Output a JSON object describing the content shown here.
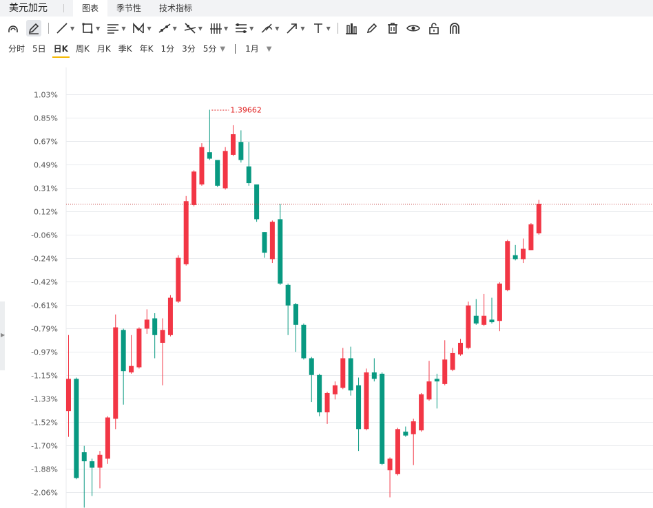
{
  "header": {
    "symbol": "美元加元",
    "tabs": [
      {
        "label": "图表",
        "active": true
      },
      {
        "label": "季节性",
        "active": false
      },
      {
        "label": "技术指标",
        "active": false
      }
    ]
  },
  "toolbar": {
    "tools": [
      {
        "icon": "magnet-circle-icon",
        "caret": false
      },
      {
        "icon": "pencil-icon",
        "caret": false,
        "selected": true
      },
      {
        "icon": "trend-line-icon",
        "caret": true
      },
      {
        "icon": "rectangle-icon",
        "caret": true
      },
      {
        "icon": "fib-lines-icon",
        "caret": true
      },
      {
        "icon": "pattern-icon",
        "caret": true
      },
      {
        "icon": "ray-icon",
        "caret": true
      },
      {
        "icon": "cross-lines-icon",
        "caret": true
      },
      {
        "icon": "gann-fan-icon",
        "caret": true
      },
      {
        "icon": "channel-icon",
        "caret": true
      },
      {
        "icon": "brush-icon",
        "caret": true
      },
      {
        "icon": "arrow-icon",
        "caret": true
      },
      {
        "icon": "text-icon",
        "caret": true
      }
    ],
    "right_tools": [
      {
        "icon": "measure-icon"
      },
      {
        "icon": "edit-icon"
      },
      {
        "icon": "trash-icon"
      },
      {
        "icon": "eye-icon"
      },
      {
        "icon": "lock-icon"
      },
      {
        "icon": "magnet-icon"
      }
    ]
  },
  "periods": {
    "items": [
      {
        "label": "分时",
        "active": false
      },
      {
        "label": "5日",
        "active": false
      },
      {
        "label": "日K",
        "active": true
      },
      {
        "label": "周K",
        "active": false
      },
      {
        "label": "月K",
        "active": false
      },
      {
        "label": "季K",
        "active": false
      },
      {
        "label": "年K",
        "active": false
      },
      {
        "label": "1分",
        "active": false
      },
      {
        "label": "3分",
        "active": false
      },
      {
        "label": "5分",
        "active": false
      }
    ],
    "range": "1月",
    "caret": "▼"
  },
  "chart_data": {
    "type": "candlestick",
    "y_ticks": [
      "1.03%",
      "0.85%",
      "0.67%",
      "0.49%",
      "0.31%",
      "0.12%",
      "-0.06%",
      "-0.24%",
      "-0.42%",
      "-0.61%",
      "-0.79%",
      "-0.97%",
      "-1.15%",
      "-1.33%",
      "-1.52%",
      "-1.70%",
      "-1.88%",
      "-2.06%"
    ],
    "ylim": [
      -2.18,
      1.15
    ],
    "max_label": "1.39662",
    "current_level": 0.18,
    "colors": {
      "up": "#f23645",
      "down": "#089981",
      "grid": "#e9ebee",
      "text": "#555555",
      "max_label": "#e02020",
      "current_line": "#c23b3b"
    },
    "candles": [
      {
        "o": -1.43,
        "c": -1.18,
        "h": -0.84,
        "l": -1.63
      },
      {
        "o": -1.18,
        "c": -1.95,
        "h": -1.17,
        "l": -1.96
      },
      {
        "o": -1.75,
        "c": -1.82,
        "h": -1.7,
        "l": -2.18
      },
      {
        "o": -1.82,
        "c": -1.87,
        "h": -1.8,
        "l": -2.09
      },
      {
        "o": -1.87,
        "c": -1.77,
        "h": -1.74,
        "l": -2.03
      },
      {
        "o": -1.8,
        "c": -1.48,
        "h": -1.47,
        "l": -1.84
      },
      {
        "o": -1.49,
        "c": -0.78,
        "h": -0.68,
        "l": -1.57
      },
      {
        "o": -0.8,
        "c": -1.12,
        "h": -0.79,
        "l": -1.38
      },
      {
        "o": -1.13,
        "c": -1.08,
        "h": -0.84,
        "l": -1.14
      },
      {
        "o": -1.09,
        "c": -0.79,
        "h": -0.78,
        "l": -1.1
      },
      {
        "o": -0.79,
        "c": -0.72,
        "h": -0.64,
        "l": -0.83
      },
      {
        "o": -0.71,
        "c": -0.84,
        "h": -0.67,
        "l": -1.02
      },
      {
        "o": -0.9,
        "c": -0.8,
        "h": -0.71,
        "l": -1.23
      },
      {
        "o": -0.84,
        "c": -0.55,
        "h": -0.53,
        "l": -0.85
      },
      {
        "o": -0.58,
        "c": -0.24,
        "h": -0.22,
        "l": -0.59
      },
      {
        "o": -0.29,
        "c": 0.2,
        "h": 0.24,
        "l": -0.3
      },
      {
        "o": 0.17,
        "c": 0.43,
        "h": 0.44,
        "l": 0.16
      },
      {
        "o": 0.33,
        "c": 0.62,
        "h": 0.65,
        "l": 0.32
      },
      {
        "o": 0.58,
        "c": 0.53,
        "h": 0.91,
        "l": 0.52
      },
      {
        "o": 0.52,
        "c": 0.32,
        "h": 0.51,
        "l": 0.31
      },
      {
        "o": 0.3,
        "c": 0.59,
        "h": 0.62,
        "l": 0.29
      },
      {
        "o": 0.56,
        "c": 0.72,
        "h": 0.79,
        "l": 0.55
      },
      {
        "o": 0.66,
        "c": 0.52,
        "h": 0.75,
        "l": 0.5
      },
      {
        "o": 0.47,
        "c": 0.34,
        "h": 0.66,
        "l": 0.32
      },
      {
        "o": 0.33,
        "c": 0.06,
        "h": 0.32,
        "l": 0.04
      },
      {
        "o": -0.04,
        "c": -0.2,
        "h": -0.04,
        "l": -0.24
      },
      {
        "o": -0.25,
        "c": 0.04,
        "h": 0.05,
        "l": -0.28
      },
      {
        "o": 0.06,
        "c": -0.44,
        "h": 0.18,
        "l": -0.45
      },
      {
        "o": -0.45,
        "c": -0.61,
        "h": -0.44,
        "l": -0.84
      },
      {
        "o": -0.6,
        "c": -0.76,
        "h": -0.59,
        "l": -0.97
      },
      {
        "o": -0.76,
        "c": -1.02,
        "h": -0.75,
        "l": -1.03
      },
      {
        "o": -1.02,
        "c": -1.15,
        "h": -1.01,
        "l": -1.36
      },
      {
        "o": -1.15,
        "c": -1.44,
        "h": -1.14,
        "l": -1.47
      },
      {
        "o": -1.44,
        "c": -1.29,
        "h": -1.28,
        "l": -1.53
      },
      {
        "o": -1.3,
        "c": -1.23,
        "h": -1.2,
        "l": -1.34
      },
      {
        "o": -1.25,
        "c": -1.02,
        "h": -0.94,
        "l": -1.26
      },
      {
        "o": -1.02,
        "c": -1.27,
        "h": -0.93,
        "l": -1.31
      },
      {
        "o": -1.23,
        "c": -1.57,
        "h": -1.17,
        "l": -1.74
      },
      {
        "o": -1.57,
        "c": -1.13,
        "h": -1.1,
        "l": -1.58
      },
      {
        "o": -1.13,
        "c": -1.18,
        "h": -1.02,
        "l": -1.2
      },
      {
        "o": -1.14,
        "c": -1.84,
        "h": -1.13,
        "l": -1.85
      },
      {
        "o": -1.89,
        "c": -1.8,
        "h": -1.79,
        "l": -2.1
      },
      {
        "o": -1.92,
        "c": -1.57,
        "h": -1.56,
        "l": -1.93
      },
      {
        "o": -1.59,
        "c": -1.62,
        "h": -1.55,
        "l": -1.63
      },
      {
        "o": -1.61,
        "c": -1.51,
        "h": -1.49,
        "l": -1.85
      },
      {
        "o": -1.58,
        "c": -1.3,
        "h": -1.29,
        "l": -1.59
      },
      {
        "o": -1.34,
        "c": -1.2,
        "h": -1.04,
        "l": -1.35
      },
      {
        "o": -1.18,
        "c": -1.2,
        "h": -1.14,
        "l": -1.41
      },
      {
        "o": -1.22,
        "c": -1.03,
        "h": -0.88,
        "l": -1.23
      },
      {
        "o": -1.11,
        "c": -0.98,
        "h": -0.94,
        "l": -1.12
      },
      {
        "o": -0.99,
        "c": -0.9,
        "h": -0.87,
        "l": -1.0
      },
      {
        "o": -0.94,
        "c": -0.61,
        "h": -0.58,
        "l": -0.95
      },
      {
        "o": -0.69,
        "c": -0.75,
        "h": -0.56,
        "l": -0.76
      },
      {
        "o": -0.76,
        "c": -0.69,
        "h": -0.52,
        "l": -0.77
      },
      {
        "o": -0.72,
        "c": -0.74,
        "h": -0.55,
        "l": -0.75
      },
      {
        "o": -0.73,
        "c": -0.44,
        "h": -0.43,
        "l": -0.81
      },
      {
        "o": -0.49,
        "c": -0.11,
        "h": -0.1,
        "l": -0.5
      },
      {
        "o": -0.22,
        "c": -0.25,
        "h": -0.14,
        "l": -0.26
      },
      {
        "o": -0.25,
        "c": -0.17,
        "h": -0.09,
        "l": -0.28
      },
      {
        "o": -0.18,
        "c": 0.02,
        "h": 0.03,
        "l": -0.18
      },
      {
        "o": -0.05,
        "c": 0.18,
        "h": 0.21,
        "l": -0.06
      }
    ]
  }
}
